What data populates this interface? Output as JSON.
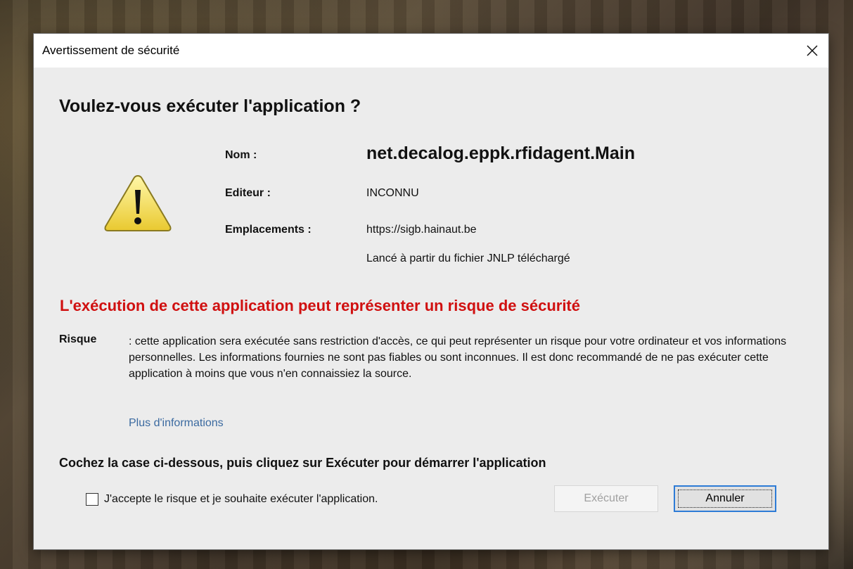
{
  "dialog": {
    "title": "Avertissement de sécurité",
    "close_icon": "close-icon",
    "heading": "Voulez-vous exécuter l'application ?",
    "warning_icon": "warning-icon",
    "fields": {
      "name_label": "Nom :",
      "name_value": "net.decalog.eppk.rfidagent.Main",
      "publisher_label": "Editeur :",
      "publisher_value": "INCONNU",
      "locations_label": "Emplacements :",
      "location_url": "https://sigb.hainaut.be",
      "location_note": "Lancé à partir du fichier JNLP téléchargé"
    },
    "risk_heading": "L'exécution de cette application peut représenter un risque de sécurité",
    "risk_label": "Risque",
    "risk_text": ": cette application sera exécutée sans restriction d'accès, ce qui peut représenter un risque pour votre ordinateur et vos informations personnelles. Les informations fournies ne sont pas fiables ou sont inconnues. Il est donc recommandé de ne pas exécuter cette application à moins que vous n'en connaissiez la source.",
    "more_info_link": "Plus d'informations",
    "instruction": "Cochez la case ci-dessous, puis cliquez sur Exécuter pour démarrer l'application",
    "accept_checkbox": {
      "label": "J'accepte le risque et je souhaite exécuter l'application.",
      "checked": false
    },
    "run_button": "Exécuter",
    "cancel_button": "Annuler"
  },
  "colors": {
    "risk_heading": "#d01010",
    "link": "#3b6aa0",
    "focus_border": "#2d7bd6",
    "warning_fill": "#f5e35a"
  }
}
